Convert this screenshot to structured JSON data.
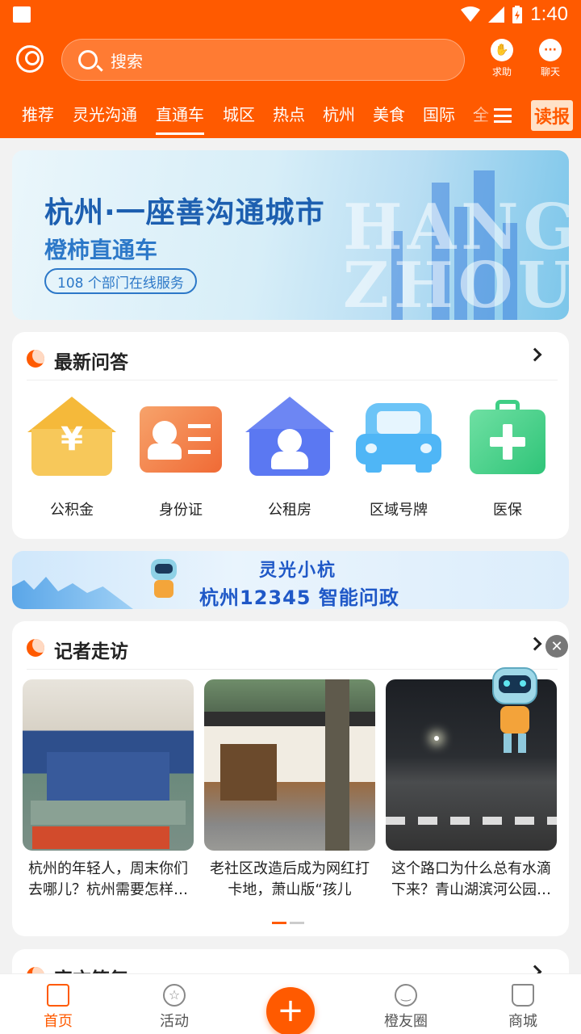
{
  "status_bar": {
    "time": "1:40"
  },
  "header": {
    "search_placeholder": "搜索",
    "help_label": "求助",
    "chat_label": "聊天",
    "tabs": [
      "推荐",
      "灵光沟通",
      "直通车",
      "城区",
      "热点",
      "杭州",
      "美食",
      "国际",
      "全"
    ],
    "active_tab": "直通车",
    "badge_text": "读报",
    "brand_color": "#ff5a00"
  },
  "banner": {
    "title": "杭州·一座善沟通城市",
    "subtitle": "橙柿直通车",
    "pill": "108 个部门在线服务",
    "watermark_1": "HANG",
    "watermark_2": "ZHOU"
  },
  "qa_section": {
    "title": "最新问答",
    "items": [
      {
        "label": "公积金",
        "icon": "yuan-house-icon",
        "color": "#f7c04a"
      },
      {
        "label": "身份证",
        "icon": "id-card-icon",
        "color": "#f47d3f"
      },
      {
        "label": "公租房",
        "icon": "house-person-icon",
        "color": "#5b78f2"
      },
      {
        "label": "区域号牌",
        "icon": "car-icon",
        "color": "#4fb6f6"
      },
      {
        "label": "医保",
        "icon": "medical-kit-icon",
        "color": "#3fcf85"
      }
    ]
  },
  "assistant_banner": {
    "line1": "灵光小杭",
    "line2": "杭州12345 智能问政"
  },
  "reporter_section": {
    "title": "记者走访",
    "articles": [
      {
        "caption": "杭州的年轻人，周末你们去哪儿？杭州需要怎样…"
      },
      {
        "caption": "老社区改造后成为网红打卡地，萧山版“孩儿巷”来…"
      },
      {
        "caption": "这个路口为什么总有水滴下来？青山湖滨河公园…"
      }
    ]
  },
  "next_section": {
    "title": "官方答复"
  },
  "bottom_nav": {
    "items": [
      {
        "label": "首页",
        "icon": "home-doc-icon"
      },
      {
        "label": "活动",
        "icon": "star-circle-icon"
      },
      {
        "label": "橙友圈",
        "icon": "smile-circle-icon"
      },
      {
        "label": "商城",
        "icon": "cart-icon"
      }
    ],
    "plus": "+"
  }
}
